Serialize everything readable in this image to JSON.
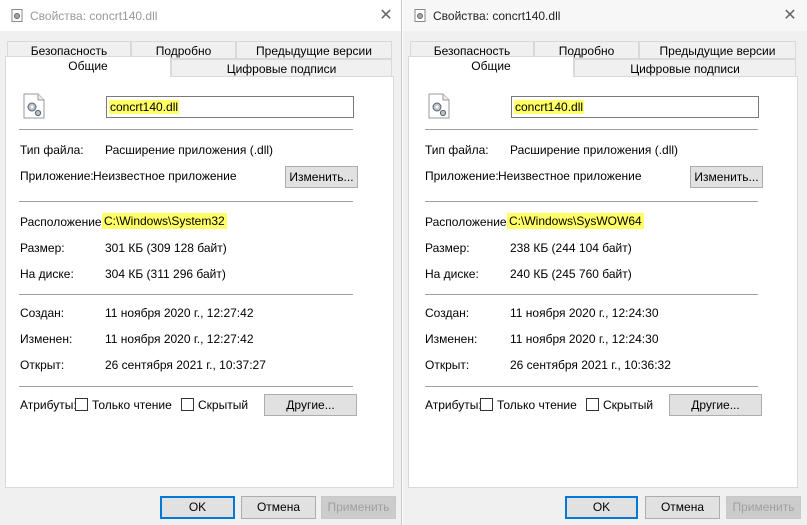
{
  "dialogs": [
    {
      "title": "Свойства: concrt140.dll",
      "close_glyph": "✕",
      "tabs_row1": [
        "Безопасность",
        "Подробно",
        "Предыдущие версии"
      ],
      "tabs_row2": [
        "Общие",
        "Цифровые подписи"
      ],
      "active_tab": "Общие",
      "file_name": "concrt140.dll",
      "file_type_label": "Тип файла:",
      "file_type_value": "Расширение приложения (.dll)",
      "app_label": "Приложение:",
      "app_value": "Неизвестное приложение",
      "change_button": "Изменить...",
      "location_label": "Расположение:",
      "location_value": "C:\\Windows\\System32",
      "size_label": "Размер:",
      "size_value": "301 КБ (309 128 байт)",
      "disk_label": "На диске:",
      "disk_value": "304 КБ (311 296 байт)",
      "created_label": "Создан:",
      "created_value": "11 ноября 2020 г., 12:27:42",
      "modified_label": "Изменен:",
      "modified_value": "11 ноября 2020 г., 12:27:42",
      "opened_label": "Открыт:",
      "opened_value": "26 сентября 2021 г., 10:37:27",
      "attributes_label": "Атрибуты:",
      "readonly_label": "Только чтение",
      "readonly_checked": false,
      "hidden_label": "Скрытый",
      "hidden_checked": false,
      "other_button": "Другие...",
      "ok_button": "OK",
      "cancel_button": "Отмена",
      "apply_button": "Применить"
    },
    {
      "title": "Свойства: concrt140.dll",
      "close_glyph": "✕",
      "tabs_row1": [
        "Безопасность",
        "Подробно",
        "Предыдущие версии"
      ],
      "tabs_row2": [
        "Общие",
        "Цифровые подписи"
      ],
      "active_tab": "Общие",
      "file_name": "concrt140.dll",
      "file_type_label": "Тип файла:",
      "file_type_value": "Расширение приложения (.dll)",
      "app_label": "Приложение:",
      "app_value": "Неизвестное приложение",
      "change_button": "Изменить...",
      "location_label": "Расположение:",
      "location_value": "C:\\Windows\\SysWOW64",
      "size_label": "Размер:",
      "size_value": "238 КБ (244 104 байт)",
      "disk_label": "На диске:",
      "disk_value": "240 КБ (245 760 байт)",
      "created_label": "Создан:",
      "created_value": "11 ноября 2020 г., 12:24:30",
      "modified_label": "Изменен:",
      "modified_value": "11 ноября 2020 г., 12:24:30",
      "opened_label": "Открыт:",
      "opened_value": "26 сентября 2021 г., 10:36:32",
      "attributes_label": "Атрибуты:",
      "readonly_label": "Только чтение",
      "readonly_checked": false,
      "hidden_label": "Скрытый",
      "hidden_checked": false,
      "other_button": "Другие...",
      "ok_button": "OK",
      "cancel_button": "Отмена",
      "apply_button": "Применить"
    }
  ],
  "colors": {
    "highlight": "#ffff66",
    "dialog_bg": "#f0f0f0",
    "panel_bg": "#ffffff",
    "ok_border": "#0078d7"
  }
}
